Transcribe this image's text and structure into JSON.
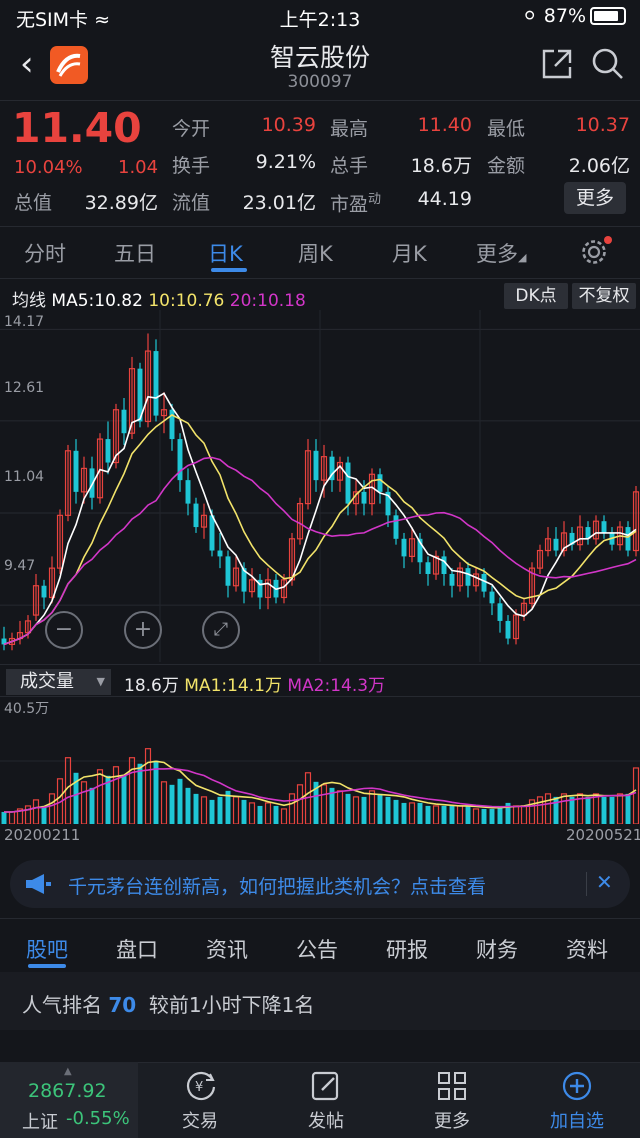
{
  "status_bar": {
    "carrier": "无SIM卡",
    "time": "上午2:13",
    "battery": "87%"
  },
  "header": {
    "title": "智云股份",
    "code": "300097"
  },
  "quote": {
    "price": "11.40",
    "change_pct": "10.04%",
    "change": "1.04",
    "open_label": "今开",
    "open": "10.39",
    "high_label": "最高",
    "high": "11.40",
    "low_label": "最低",
    "low": "10.37",
    "turnover_label": "换手",
    "turnover": "9.21%",
    "volume_label": "总手",
    "volume": "18.6万",
    "amount_label": "金额",
    "amount": "2.06亿",
    "mcap_label": "总值",
    "mcap": "32.89亿",
    "float_label": "流值",
    "float": "23.01亿",
    "pe_label": "市盈",
    "pe_sup": "动",
    "pe": "44.19",
    "more_label": "更多"
  },
  "chart_tabs": [
    "分时",
    "五日",
    "日K",
    "周K",
    "月K",
    "更多"
  ],
  "legend": {
    "title": "均线",
    "ma5": "MA5:10.82",
    "ma10": "10:10.76",
    "ma20": "20:10.18",
    "dk": "DK点",
    "adjust": "不复权"
  },
  "colors": {
    "up": "#e8433e",
    "down": "#1fc6d5",
    "ma5": "#ffffff",
    "ma10": "#f2e36a",
    "ma20": "#d236c8",
    "accent": "#3d8ae8"
  },
  "price_axis": [
    "14.17",
    "12.61",
    "11.04",
    "9.47"
  ],
  "volume": {
    "selector": "成交量",
    "value": "18.6万",
    "ma1": "MA1:14.1万",
    "ma2": "MA2:14.3万",
    "axis_max": "40.5万"
  },
  "dates": {
    "start": "20200211",
    "end": "20200521"
  },
  "chart_data": {
    "type": "candlestick",
    "price_range": [
      8.5,
      14.5
    ],
    "volume_max": 40.5,
    "candles": [
      [
        8.9,
        8.8,
        9.1,
        8.7,
        4
      ],
      [
        8.8,
        8.9,
        9.0,
        8.7,
        4
      ],
      [
        8.9,
        9.0,
        9.2,
        8.8,
        5
      ],
      [
        9.0,
        9.2,
        9.3,
        8.9,
        6
      ],
      [
        9.3,
        9.8,
        10.0,
        9.2,
        8
      ],
      [
        9.8,
        9.6,
        9.9,
        9.4,
        6
      ],
      [
        9.6,
        10.1,
        10.3,
        9.5,
        10
      ],
      [
        10.1,
        11.0,
        11.1,
        10.0,
        15
      ],
      [
        11.0,
        12.1,
        12.2,
        10.9,
        22
      ],
      [
        12.1,
        11.4,
        12.3,
        11.2,
        17
      ],
      [
        11.4,
        11.8,
        12.0,
        11.2,
        14
      ],
      [
        11.8,
        11.3,
        12.0,
        11.1,
        12
      ],
      [
        11.3,
        12.3,
        12.4,
        11.2,
        18
      ],
      [
        12.3,
        11.9,
        12.6,
        11.7,
        16
      ],
      [
        11.9,
        12.8,
        12.9,
        11.8,
        19
      ],
      [
        12.8,
        12.4,
        13.0,
        12.2,
        16
      ],
      [
        12.4,
        13.5,
        13.7,
        12.3,
        22
      ],
      [
        13.5,
        12.6,
        13.6,
        12.5,
        20
      ],
      [
        12.6,
        13.8,
        14.1,
        12.5,
        25
      ],
      [
        13.8,
        12.7,
        14.0,
        12.6,
        21
      ],
      [
        12.7,
        12.8,
        13.1,
        12.4,
        14
      ],
      [
        12.8,
        12.3,
        12.9,
        12.1,
        13
      ],
      [
        12.3,
        11.6,
        12.4,
        11.4,
        15
      ],
      [
        11.6,
        11.2,
        11.8,
        11.0,
        12
      ],
      [
        11.2,
        10.8,
        11.3,
        10.7,
        10
      ],
      [
        10.8,
        11.0,
        11.2,
        10.6,
        9
      ],
      [
        11.0,
        10.4,
        11.1,
        10.3,
        8
      ],
      [
        10.4,
        10.3,
        10.7,
        10.1,
        9
      ],
      [
        10.3,
        9.8,
        10.4,
        9.6,
        11
      ],
      [
        9.8,
        10.1,
        10.3,
        9.7,
        9
      ],
      [
        10.1,
        9.7,
        10.2,
        9.5,
        8
      ],
      [
        9.7,
        9.9,
        10.1,
        9.6,
        7
      ],
      [
        9.9,
        9.6,
        10.0,
        9.4,
        6
      ],
      [
        9.6,
        9.9,
        10.1,
        9.4,
        7
      ],
      [
        9.9,
        9.6,
        10.0,
        9.5,
        6
      ],
      [
        9.6,
        9.9,
        10.0,
        9.5,
        5
      ],
      [
        9.9,
        10.6,
        10.7,
        9.8,
        10
      ],
      [
        10.6,
        11.2,
        11.3,
        10.5,
        13
      ],
      [
        11.2,
        12.1,
        12.3,
        11.1,
        17
      ],
      [
        12.1,
        11.6,
        12.3,
        11.4,
        14
      ],
      [
        11.6,
        12.0,
        12.2,
        11.3,
        13
      ],
      [
        12.0,
        11.6,
        12.1,
        11.4,
        12
      ],
      [
        11.6,
        11.9,
        12.0,
        11.4,
        11
      ],
      [
        11.9,
        11.2,
        12.0,
        11.0,
        10
      ],
      [
        11.2,
        11.4,
        11.6,
        11.0,
        9
      ],
      [
        11.4,
        11.2,
        11.6,
        11.0,
        9
      ],
      [
        11.2,
        11.7,
        11.8,
        11.0,
        11
      ],
      [
        11.7,
        11.4,
        11.8,
        11.2,
        10
      ],
      [
        11.4,
        11.0,
        11.5,
        10.8,
        9
      ],
      [
        11.0,
        10.6,
        11.1,
        10.5,
        8
      ],
      [
        10.6,
        10.3,
        10.7,
        10.1,
        7
      ],
      [
        10.3,
        10.6,
        10.8,
        10.2,
        7
      ],
      [
        10.6,
        10.2,
        10.7,
        10.0,
        7
      ],
      [
        10.2,
        10.0,
        10.3,
        9.8,
        6
      ],
      [
        10.0,
        10.3,
        10.4,
        9.9,
        6
      ],
      [
        10.3,
        10.0,
        10.4,
        9.8,
        6
      ],
      [
        10.0,
        9.8,
        10.1,
        9.6,
        6
      ],
      [
        9.8,
        10.1,
        10.2,
        9.7,
        6
      ],
      [
        10.1,
        9.8,
        10.2,
        9.6,
        6
      ],
      [
        9.8,
        10.0,
        10.1,
        9.7,
        5
      ],
      [
        10.0,
        9.7,
        10.1,
        9.6,
        5
      ],
      [
        9.7,
        9.5,
        9.8,
        9.3,
        5
      ],
      [
        9.5,
        9.2,
        9.6,
        9.0,
        6
      ],
      [
        9.2,
        8.9,
        9.3,
        8.8,
        7
      ],
      [
        8.9,
        9.3,
        9.4,
        8.8,
        6
      ],
      [
        9.3,
        9.5,
        9.6,
        9.2,
        6
      ],
      [
        9.5,
        10.1,
        10.2,
        9.4,
        8
      ],
      [
        10.1,
        10.4,
        10.5,
        10.0,
        9
      ],
      [
        10.4,
        10.6,
        10.8,
        10.3,
        10
      ],
      [
        10.6,
        10.4,
        10.8,
        10.3,
        9
      ],
      [
        10.4,
        10.7,
        10.9,
        10.3,
        10
      ],
      [
        10.7,
        10.5,
        10.8,
        10.4,
        9
      ],
      [
        10.5,
        10.8,
        11.0,
        10.4,
        10
      ],
      [
        10.8,
        10.6,
        10.9,
        10.5,
        9
      ],
      [
        10.6,
        10.9,
        11.0,
        10.5,
        10
      ],
      [
        10.9,
        10.7,
        11.0,
        10.6,
        9
      ],
      [
        10.7,
        10.5,
        10.8,
        10.4,
        9
      ],
      [
        10.5,
        10.8,
        10.9,
        10.4,
        10
      ],
      [
        10.8,
        10.4,
        10.9,
        10.3,
        10
      ],
      [
        10.4,
        11.4,
        11.5,
        10.3,
        18.6
      ]
    ]
  },
  "banner": {
    "text": "千元茅台连创新高，如何把握此类机会？点击查看"
  },
  "bottom_tabs": [
    "股吧",
    "盘口",
    "资讯",
    "公告",
    "研报",
    "财务",
    "资料"
  ],
  "rank": {
    "prefix": "人气排名",
    "value": "70",
    "suffix": "较前1小时下降1名"
  },
  "nav": {
    "index_value": "2867.92",
    "index_name": "上证",
    "index_change": "-0.55%",
    "trade": "交易",
    "post": "发帖",
    "more": "更多",
    "add": "加自选"
  }
}
